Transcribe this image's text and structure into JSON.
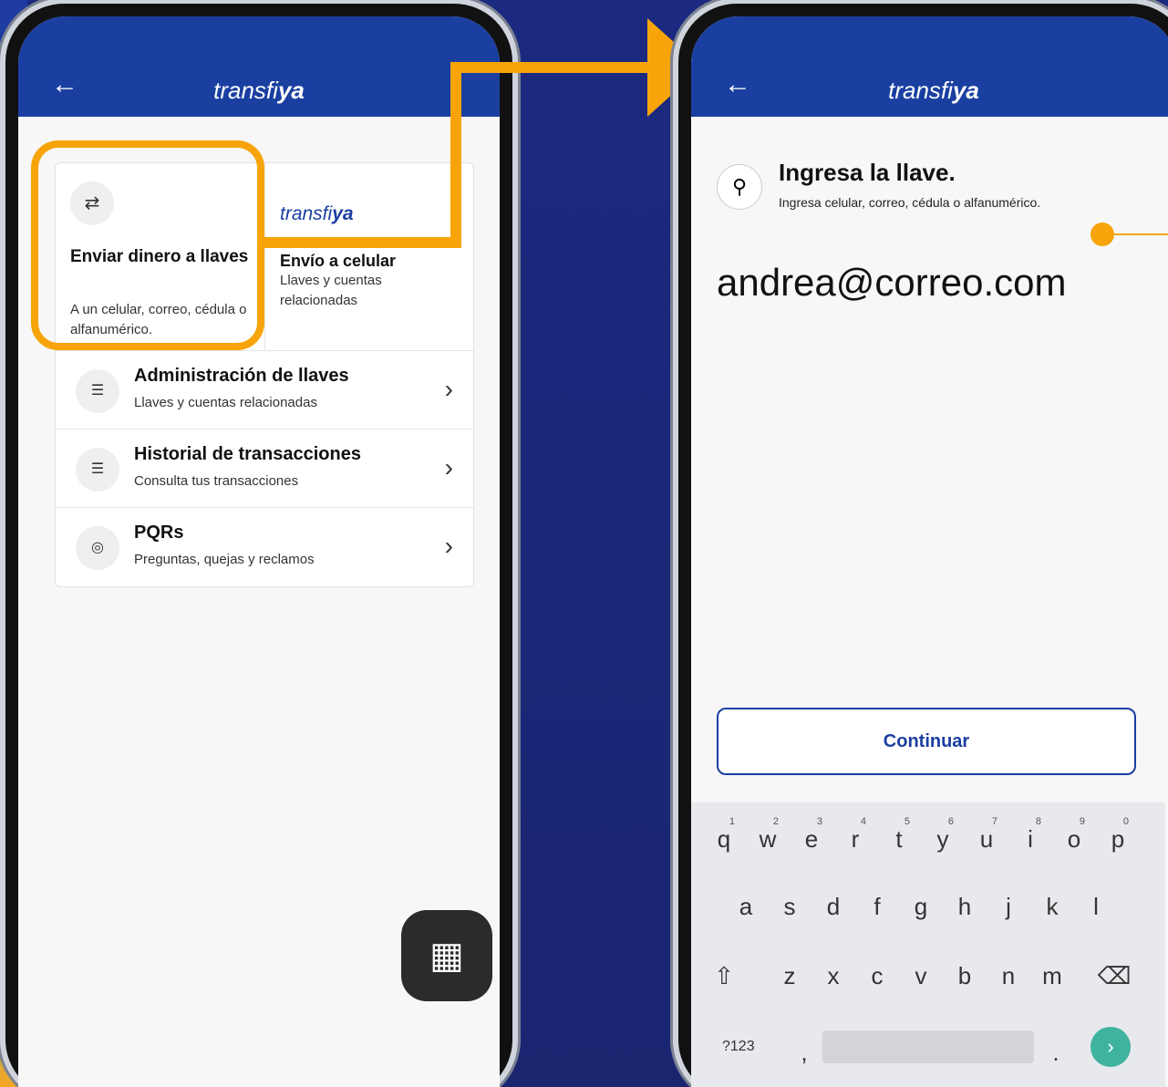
{
  "colors": {
    "brand": "#1a3fa1",
    "accent": "#f7a40a"
  },
  "left_phone": {
    "header": {
      "back_icon": "arrow-left-icon",
      "logo_prefix": "transfi",
      "logo_bold": "ya"
    },
    "tile_a": {
      "icon": "transfer-arrows-icon",
      "title": "Enviar dinero a llaves",
      "subtitle": "A un celular, correo, cédula o alfanumérico."
    },
    "tile_b": {
      "logo_prefix": "transfi",
      "logo_bold": "ya",
      "title": "Envío a celular",
      "subtitle": "Llaves y cuentas relacionadas"
    },
    "rows": [
      {
        "icon": "list-icon",
        "title": "Administración de llaves",
        "subtitle": "Llaves y cuentas relacionadas"
      },
      {
        "icon": "list-icon",
        "title": "Historial de transacciones",
        "subtitle": "Consulta tus transacciones"
      },
      {
        "icon": "headset-icon",
        "title": "PQRs",
        "subtitle": "Preguntas, quejas y reclamos"
      }
    ],
    "qr_icon": "qr-code-icon"
  },
  "right_phone": {
    "header": {
      "back_icon": "arrow-left-icon",
      "logo_prefix": "transfi",
      "logo_bold": "ya"
    },
    "key_icon": "key-icon",
    "heading": "Ingresa la llave.",
    "subheading": "Ingresa celular, correo, cédula o alfanumérico.",
    "input_value": "andrea@correo.com",
    "continue_label": "Continuar",
    "keyboard": {
      "row1": [
        "q",
        "w",
        "e",
        "r",
        "t",
        "y",
        "u",
        "i",
        "o",
        "p"
      ],
      "row1_nums": [
        "1",
        "2",
        "3",
        "4",
        "5",
        "6",
        "7",
        "8",
        "9",
        "0"
      ],
      "row2": [
        "a",
        "s",
        "d",
        "f",
        "g",
        "h",
        "j",
        "k",
        "l"
      ],
      "row3": [
        "z",
        "x",
        "c",
        "v",
        "b",
        "n",
        "m"
      ],
      "sym_label": "?123",
      "comma": ",",
      "period": "."
    }
  }
}
